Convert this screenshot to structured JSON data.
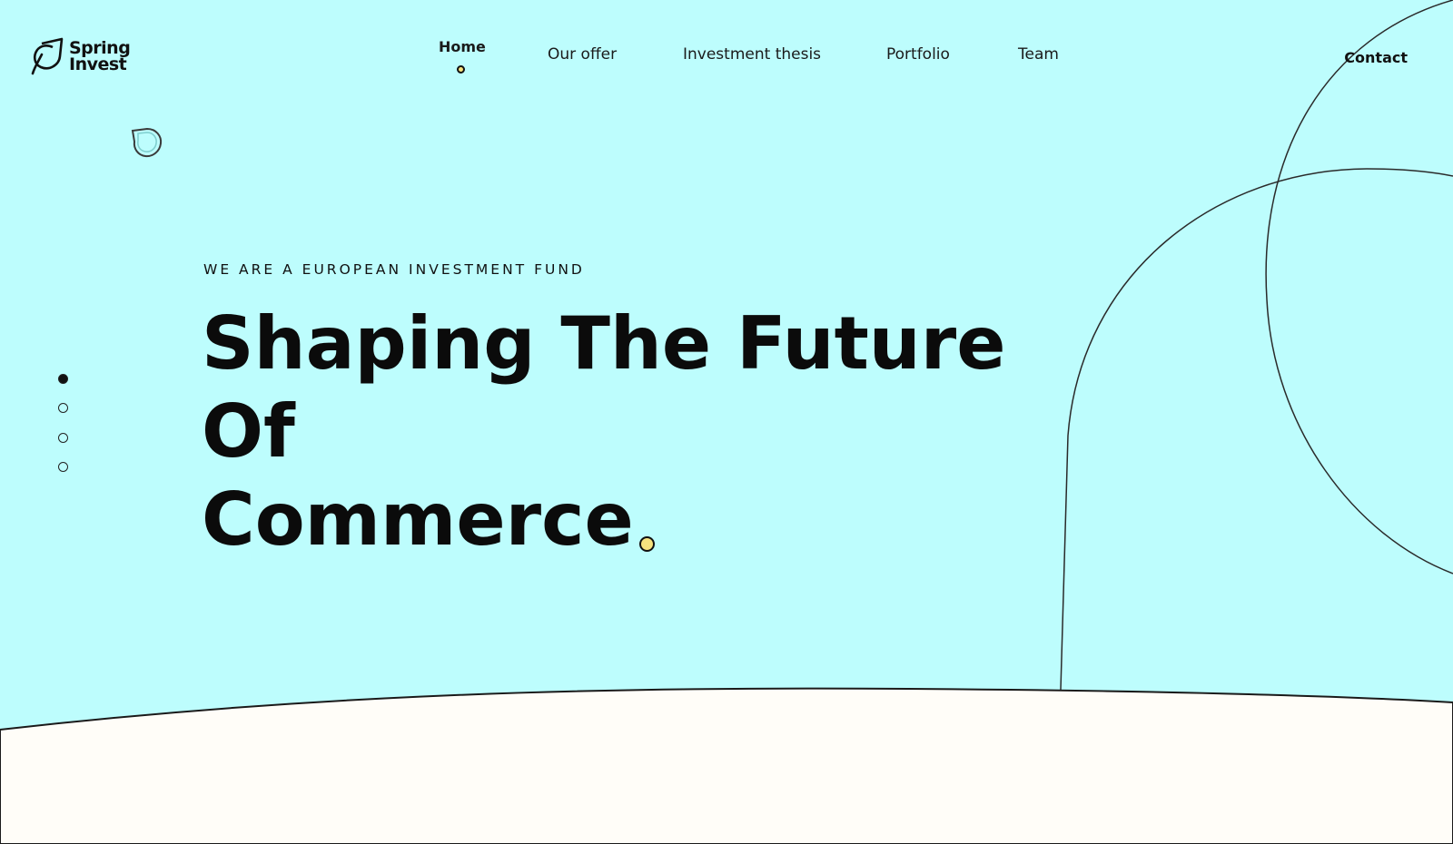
{
  "brand": {
    "line1": "Spring",
    "line2": "Invest"
  },
  "nav": {
    "items": [
      {
        "label": "Home",
        "active": true
      },
      {
        "label": "Our offer",
        "active": false
      },
      {
        "label": "Investment thesis",
        "active": false
      },
      {
        "label": "Portfolio",
        "active": false
      },
      {
        "label": "Team",
        "active": false
      }
    ],
    "contact": "Contact"
  },
  "hero": {
    "eyebrow": "WE ARE A EUROPEAN INVESTMENT FUND",
    "headline_line1": "Shaping The Future",
    "headline_line2": "Of",
    "headline_line3": "Commerce"
  },
  "slider": {
    "count": 4,
    "active_index": 0
  },
  "icons": {
    "logo": "spring-leaf-logo-icon",
    "decor": "leaf-bubble-icon"
  },
  "colors": {
    "hero_bg": "#bdfdfd",
    "lower_bg": "#fffdf8",
    "accent_yellow": "#f7e27e",
    "text": "#111111"
  }
}
